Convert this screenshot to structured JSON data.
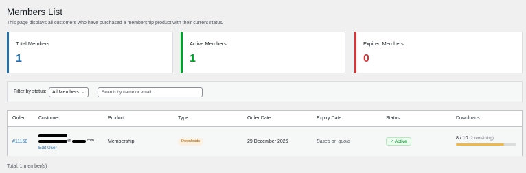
{
  "page": {
    "title": "Members List",
    "description": "This page displays all customers who have purchased a membership product with their current status."
  },
  "stats": {
    "total": {
      "label": "Total Members",
      "value": "1",
      "color": "#2271b1"
    },
    "active": {
      "label": "Active Members",
      "value": "1",
      "color": "#00a32a"
    },
    "expired": {
      "label": "Expired Members",
      "value": "0",
      "color": "#d63638"
    }
  },
  "filters": {
    "status_label": "Filter by status:",
    "status_selected": "All Members",
    "search_placeholder": "Search by name or email..."
  },
  "table": {
    "columns": [
      "Order",
      "Customer",
      "Product",
      "Type",
      "Order Date",
      "Expiry Date",
      "Status",
      "Downloads"
    ],
    "rows": [
      {
        "order": "#11158",
        "customer_email_at": "@",
        "customer_email_domain": ".com",
        "edit_user": "Edit User",
        "product": "Membership",
        "type": "Downloads",
        "order_date": "29 December 2025",
        "expiry_date": "Based on quota",
        "status": "✓ Active",
        "downloads_used": "8 / 10",
        "downloads_remaining": "(2 remaining)",
        "downloads_progress": 0.8
      }
    ]
  },
  "footer": {
    "total": "Total: 1 member(s)"
  },
  "icons": {
    "select_chevron": "chevron-down-icon",
    "status_check": "check-icon"
  }
}
